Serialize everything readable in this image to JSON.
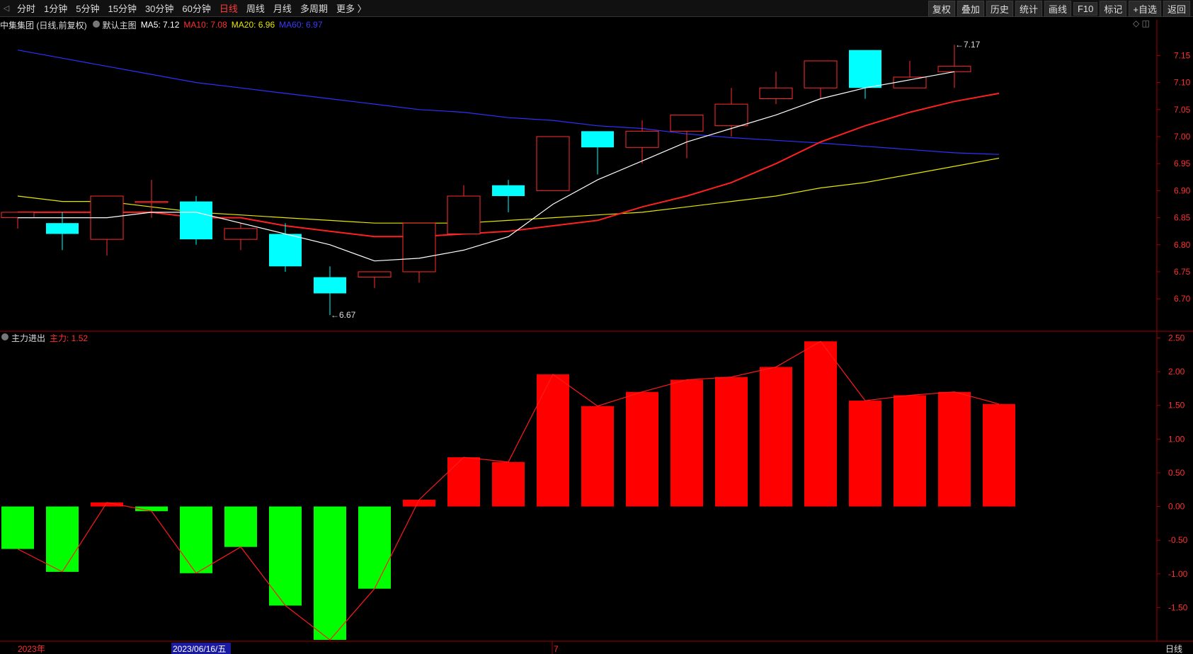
{
  "toolbar": {
    "periods": [
      "分时",
      "1分钟",
      "5分钟",
      "15分钟",
      "30分钟",
      "60分钟",
      "日线",
      "周线",
      "月线",
      "多周期",
      "更多 〉"
    ],
    "active_index": 6,
    "tools": [
      "复权",
      "叠加",
      "历史",
      "统计",
      "画线",
      "F10",
      "标记",
      "+自选",
      "返回"
    ]
  },
  "info": {
    "stock": "中集集团 (日线,前复权)",
    "main_chart": "默认主图",
    "ma5": "MA5: 7.12",
    "ma10": "MA10: 7.08",
    "ma20": "MA20: 6.96",
    "ma60": "MA60: 6.97"
  },
  "sub_info": {
    "name": "主力进出",
    "value": "主力: 1.52"
  },
  "corner_icons": "◇ ◫",
  "status": {
    "year": "2023年",
    "date": "2023/06/16/五",
    "month_mark": "7",
    "period": "日线"
  },
  "colors": {
    "up": "#ff2d2d",
    "down": "#00ffff",
    "ma5": "#ffffff",
    "ma10": "#ff2020",
    "ma20": "#e6e600",
    "ma60": "#3030ff",
    "bar_up": "#ff0000",
    "bar_down": "#00ff00"
  },
  "chart_data": [
    {
      "type": "candlestick",
      "yticks": [
        6.7,
        6.75,
        6.8,
        6.85,
        6.9,
        6.95,
        7.0,
        7.05,
        7.1,
        7.15
      ],
      "ylim": [
        6.64,
        7.195
      ],
      "ohlc": [
        [
          6.85,
          6.86,
          6.83,
          6.86
        ],
        [
          6.84,
          6.86,
          6.79,
          6.82
        ],
        [
          6.81,
          6.89,
          6.78,
          6.89
        ],
        [
          6.88,
          6.92,
          6.85,
          6.88
        ],
        [
          6.88,
          6.89,
          6.8,
          6.81
        ],
        [
          6.81,
          6.84,
          6.79,
          6.83
        ],
        [
          6.82,
          6.84,
          6.75,
          6.76
        ],
        [
          6.74,
          6.76,
          6.67,
          6.71
        ],
        [
          6.74,
          6.75,
          6.72,
          6.75
        ],
        [
          6.75,
          6.84,
          6.73,
          6.84
        ],
        [
          6.82,
          6.91,
          6.82,
          6.89
        ],
        [
          6.91,
          6.92,
          6.86,
          6.89
        ],
        [
          6.9,
          7.0,
          6.9,
          7.0
        ],
        [
          7.01,
          7.01,
          6.93,
          6.98
        ],
        [
          6.98,
          7.03,
          6.95,
          7.01
        ],
        [
          7.01,
          7.04,
          6.96,
          7.04
        ],
        [
          7.02,
          7.09,
          7.0,
          7.06
        ],
        [
          7.07,
          7.12,
          7.06,
          7.09
        ],
        [
          7.09,
          7.14,
          7.07,
          7.14
        ],
        [
          7.16,
          7.16,
          7.07,
          7.09
        ],
        [
          7.09,
          7.14,
          7.09,
          7.11
        ],
        [
          7.12,
          7.17,
          7.09,
          7.13
        ]
      ],
      "ma5": [
        6.85,
        6.85,
        6.85,
        6.86,
        6.86,
        6.84,
        6.82,
        6.8,
        6.77,
        6.775,
        6.79,
        6.815,
        6.875,
        6.92,
        6.955,
        6.99,
        7.015,
        7.04,
        7.07,
        7.09,
        7.105,
        7.12
      ],
      "ma10": [
        6.86,
        6.86,
        6.86,
        6.86,
        6.85,
        6.85,
        6.835,
        6.825,
        6.815,
        6.815,
        6.82,
        6.825,
        6.835,
        6.845,
        6.87,
        6.89,
        6.915,
        6.95,
        6.99,
        7.02,
        7.045,
        7.065,
        7.08
      ],
      "ma20": [
        6.89,
        6.88,
        6.88,
        6.87,
        6.86,
        6.855,
        6.85,
        6.845,
        6.84,
        6.84,
        6.84,
        6.845,
        6.85,
        6.855,
        6.86,
        6.87,
        6.88,
        6.89,
        6.905,
        6.915,
        6.93,
        6.945,
        6.96
      ],
      "ma60": [
        7.16,
        7.145,
        7.13,
        7.115,
        7.1,
        7.09,
        7.08,
        7.07,
        7.06,
        7.05,
        7.045,
        7.035,
        7.03,
        7.02,
        7.015,
        7.005,
        6.998,
        6.993,
        6.988,
        6.982,
        6.976,
        6.97,
        6.967
      ],
      "annotations": [
        {
          "label": "6.67",
          "index": 7,
          "price": 6.67
        },
        {
          "label": "7.17",
          "index": 21,
          "price": 7.17
        }
      ]
    },
    {
      "type": "bar",
      "title": "主力进出",
      "yticks": [
        -1.5,
        -1.0,
        -0.5,
        0.0,
        0.5,
        1.0,
        1.5,
        2.0,
        2.5
      ],
      "ylim": [
        -2.0,
        2.6
      ],
      "values": [
        -0.63,
        -0.97,
        0.06,
        -0.07,
        -0.99,
        -0.6,
        -1.47,
        -1.98,
        -1.22,
        0.1,
        0.73,
        0.66,
        1.96,
        1.49,
        1.7,
        1.88,
        1.92,
        2.07,
        2.45,
        1.57,
        1.65,
        1.7,
        1.52
      ]
    }
  ]
}
